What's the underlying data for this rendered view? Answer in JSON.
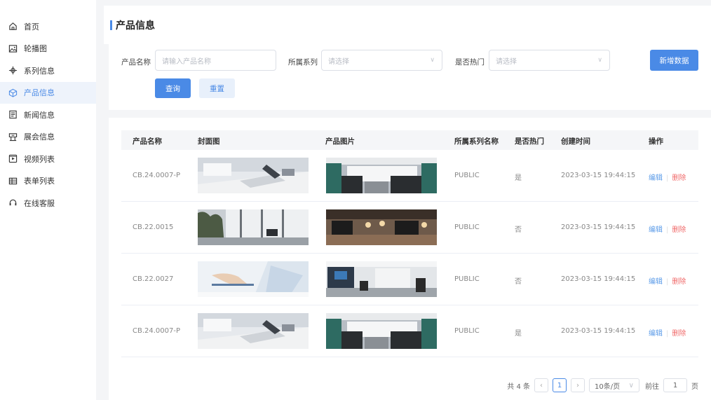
{
  "sidebar": {
    "items": [
      {
        "label": "首页",
        "icon": "home-icon"
      },
      {
        "label": "轮播图",
        "icon": "image-icon"
      },
      {
        "label": "系列信息",
        "icon": "series-icon"
      },
      {
        "label": "产品信息",
        "icon": "cube-icon",
        "active": true
      },
      {
        "label": "新闻信息",
        "icon": "news-icon"
      },
      {
        "label": "展会信息",
        "icon": "exhibition-icon"
      },
      {
        "label": "视频列表",
        "icon": "video-icon"
      },
      {
        "label": "表单列表",
        "icon": "table-icon"
      },
      {
        "label": "在线客服",
        "icon": "headset-icon"
      }
    ]
  },
  "page": {
    "title": "产品信息"
  },
  "filters": {
    "name_label": "产品名称",
    "name_placeholder": "请输入产品名称",
    "series_label": "所属系列",
    "series_placeholder": "请选择",
    "hot_label": "是否热门",
    "hot_placeholder": "请选择",
    "add_label": "新增数据",
    "query_label": "查询",
    "reset_label": "重置"
  },
  "table": {
    "columns": [
      "产品名称",
      "封面图",
      "产品图片",
      "所属系列名称",
      "是否热门",
      "创建时间",
      "操作"
    ],
    "rows": [
      {
        "name": "CB.24.0007-P",
        "series": "PUBLIC",
        "hot": "是",
        "created": "2023-03-15 19:44:15",
        "cover": "laptop-desk",
        "photo": "theater-chairs"
      },
      {
        "name": "CB.22.0015",
        "series": "PUBLIC",
        "hot": "否",
        "created": "2023-03-15 19:44:15",
        "cover": "office-window",
        "photo": "cafe-room"
      },
      {
        "name": "CB.22.0027",
        "series": "PUBLIC",
        "hot": "否",
        "created": "2023-03-15 19:44:15",
        "cover": "hand-writing",
        "photo": "meeting-room"
      },
      {
        "name": "CB.24.0007-P",
        "series": "PUBLIC",
        "hot": "是",
        "created": "2023-03-15 19:44:15",
        "cover": "laptop-desk",
        "photo": "theater-chairs"
      }
    ],
    "edit_label": "编辑",
    "delete_label": "删除"
  },
  "pagination": {
    "total": "共 4 条",
    "current_page": "1",
    "page_size": "10条/页",
    "goto_label": "前往",
    "goto_value": "1",
    "page_suffix": "页"
  },
  "colors": {
    "accent": "#4a8ae6",
    "danger": "#f06a6a",
    "active_bg": "#eef3fb"
  }
}
